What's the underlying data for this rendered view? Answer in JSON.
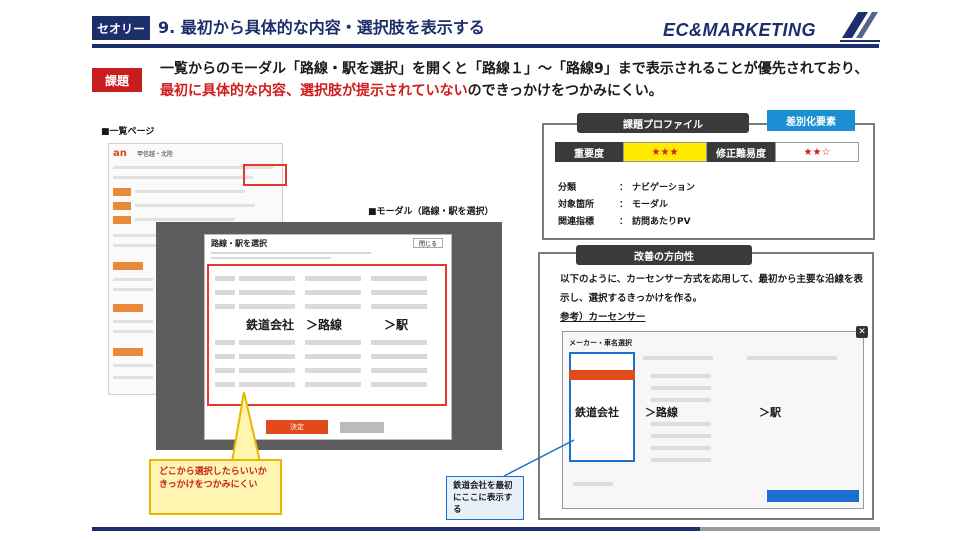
{
  "header": {
    "theory_badge": "セオリー",
    "title": "9. 最初から具体的な内容・選択肢を表示する",
    "logo": "EC&MARKETING"
  },
  "issue": {
    "badge": "課題",
    "text_before": "一覧からのモーダル「路線・駅を選択」を開くと「路線１」〜「路線9」まで表示されることが優先されており、",
    "text_red": "最初に具体的な内容、選択肢が提示されていない",
    "text_after": "のできっかけをつかみにくい。"
  },
  "left": {
    "list_label": "■一覧ページ",
    "modal_label": "■モーダル（路線・駅を選択）",
    "list_brand": "an",
    "list_brand_region": "甲信越・北陸",
    "modal_title": "路線・駅を選択",
    "modal_close": "閉じる",
    "modal_go": "決定",
    "modal_hint_rail": "鉄道会社",
    "modal_hint_line": "＞路線",
    "modal_hint_station": "＞駅",
    "callout": "どこから選択したらいいかきっかけをつかみにくい"
  },
  "profile": {
    "head": "課題プロファイル",
    "diff_badge": "差別化要素",
    "importance_label": "重要度",
    "importance_value": "★★★",
    "difficulty_label": "修正難易度",
    "difficulty_value": "★★☆",
    "items": [
      {
        "key": "分類",
        "value": "ナビゲーション"
      },
      {
        "key": "対象箇所",
        "value": "モーダル"
      },
      {
        "key": "関連指標",
        "value": "訪問あたりPV"
      }
    ]
  },
  "improvement": {
    "head": "改善の方向性",
    "text": "以下のように、カーセンサー方式を応用して、最初から主要な沿線を表示し、選択するきっかけを作る。",
    "ref": "参考）カーセンサー",
    "shot_title": "メーカー・車名選択",
    "hint_rail": "鉄道会社",
    "hint_line": "＞路線",
    "hint_station": "＞駅",
    "callout": "鉄道会社を最初にここに表示する"
  },
  "colors": {
    "navy": "#1d2f6b",
    "red": "#c91c1c",
    "accent_blue": "#1a8fd3",
    "highlight_yellow": "#fff5b0"
  }
}
